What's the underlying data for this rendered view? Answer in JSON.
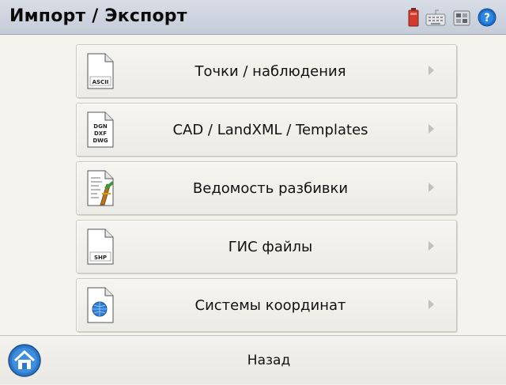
{
  "window": {
    "title": "Импорт / Экспорт"
  },
  "status_icons": [
    "battery-icon",
    "keyboard-icon",
    "settings-icon",
    "help-icon"
  ],
  "menu": [
    {
      "label": "Точки / наблюдения",
      "icon": "ascii-file-icon",
      "icon_text": "ASCII"
    },
    {
      "label": "CAD / LandXML / Templates",
      "icon": "dgn-dxf-dwg-file-icon",
      "icon_text": "DGN DXF DWG"
    },
    {
      "label": "Ведомость разбивки",
      "icon": "stakeout-report-icon",
      "icon_text": ""
    },
    {
      "label": "ГИС файлы",
      "icon": "shp-file-icon",
      "icon_text": "SHP"
    },
    {
      "label": "Системы координат",
      "icon": "globe-file-icon",
      "icon_text": ""
    }
  ],
  "bottom": {
    "back_label": "Назад"
  },
  "colors": {
    "titlebar": "#c9d0dc",
    "background": "#f4f3ee",
    "help": "#1f6fc9",
    "battery": "#d33b2c"
  }
}
